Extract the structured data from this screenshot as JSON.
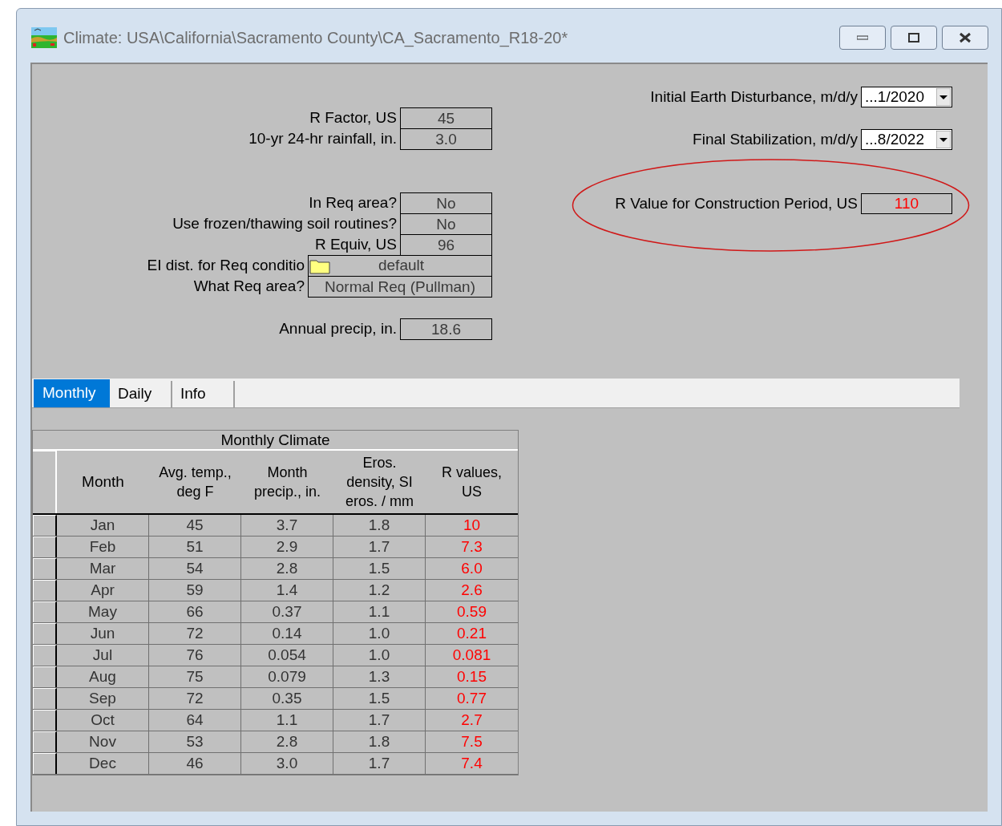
{
  "window": {
    "title": "Climate:  USA\\California\\Sacramento County\\CA_Sacramento_R18-20*"
  },
  "left_groups": [
    [
      {
        "label": "R Factor, US",
        "value": "45",
        "kind": "box"
      },
      {
        "label": "10-yr 24-hr rainfall, in.",
        "value": "3.0",
        "kind": "box"
      }
    ],
    [
      {
        "label": "In Req area?",
        "value": "No",
        "kind": "box"
      },
      {
        "label": "Use frozen/thawing soil routines?",
        "value": "No",
        "kind": "box"
      },
      {
        "label": "R Equiv, US",
        "value": "96",
        "kind": "box"
      },
      {
        "label": "EI dist. for Req conditio",
        "value": "default",
        "kind": "file"
      },
      {
        "label": "What Req area?",
        "value": "Normal Req (Pullman)",
        "kind": "wide"
      }
    ],
    [
      {
        "label": "Annual precip, in.",
        "value": "18.6",
        "kind": "box"
      }
    ]
  ],
  "right_fields": [
    {
      "label": "Initial Earth Disturbance, m/d/y",
      "value": "...1/2020",
      "kind": "dropdown",
      "circled": false
    },
    {
      "label": "Final Stabilization, m/d/y",
      "value": "...8/2022",
      "kind": "dropdown",
      "circled": false
    },
    {
      "label": "R Value for Construction Period, US",
      "value": "110",
      "kind": "result",
      "circled": true
    }
  ],
  "tabs": [
    {
      "label": "Monthly",
      "selected": true
    },
    {
      "label": "Daily",
      "selected": false
    },
    {
      "label": "Info",
      "selected": false
    }
  ],
  "table": {
    "title": "Monthly Climate",
    "columns": [
      {
        "label": "Month",
        "kind": "plain"
      },
      {
        "label": "Avg. temp.,\ndeg F",
        "kind": "plain"
      },
      {
        "label": "Month\nprecip., in.",
        "kind": "plain"
      },
      {
        "label": "Eros.\ndensity, SI\neros. / mm",
        "kind": "plain"
      },
      {
        "label": "R values,\nUS",
        "kind": "result"
      }
    ],
    "rows": [
      [
        "Jan",
        "45",
        "3.7",
        "1.8",
        "10"
      ],
      [
        "Feb",
        "51",
        "2.9",
        "1.7",
        "7.3"
      ],
      [
        "Mar",
        "54",
        "2.8",
        "1.5",
        "6.0"
      ],
      [
        "Apr",
        "59",
        "1.4",
        "1.2",
        "2.6"
      ],
      [
        "May",
        "66",
        "0.37",
        "1.1",
        "0.59"
      ],
      [
        "Jun",
        "72",
        "0.14",
        "1.0",
        "0.21"
      ],
      [
        "Jul",
        "76",
        "0.054",
        "1.0",
        "0.081"
      ],
      [
        "Aug",
        "75",
        "0.079",
        "1.3",
        "0.15"
      ],
      [
        "Sep",
        "72",
        "0.35",
        "1.5",
        "0.77"
      ],
      [
        "Oct",
        "64",
        "1.1",
        "1.7",
        "2.7"
      ],
      [
        "Nov",
        "53",
        "2.8",
        "1.8",
        "7.5"
      ],
      [
        "Dec",
        "46",
        "3.0",
        "1.7",
        "7.4"
      ]
    ]
  }
}
